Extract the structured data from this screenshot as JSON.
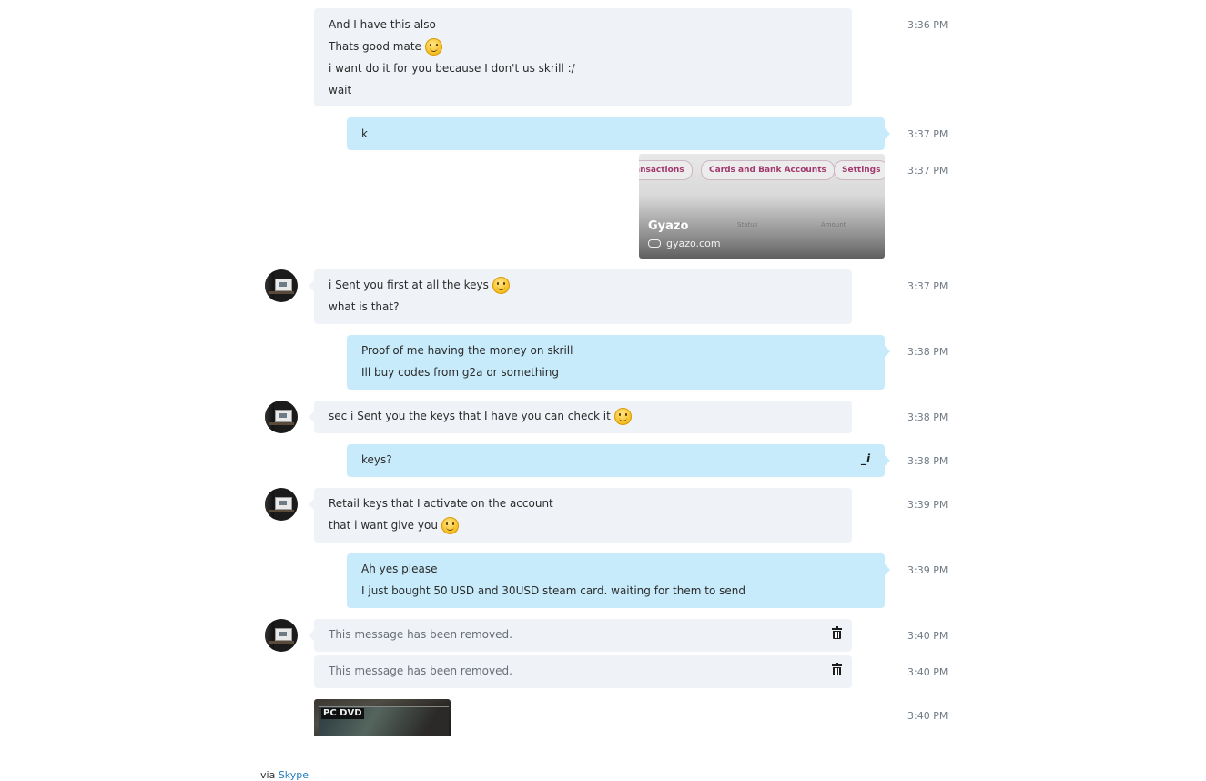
{
  "messages": [
    {
      "id": "m1",
      "time": "3:36 PM",
      "lines": [
        "And I have this also",
        "Thats good mate",
        "i want do it for you because I don't us skrill :/",
        "wait"
      ]
    },
    {
      "id": "m2",
      "time": "3:37 PM",
      "lines": [
        "k"
      ]
    },
    {
      "id": "m3",
      "time": "3:37 PM",
      "link_preview": {
        "title": "Gyazo",
        "site": "gyazo.com",
        "pills": [
          "ansactions",
          "Cards and Bank Accounts",
          "Settings"
        ],
        "columns": [
          "ate",
          "Status",
          "Amount"
        ]
      }
    },
    {
      "id": "m4",
      "time": "3:37 PM",
      "lines": [
        "i Sent you first at all the keys",
        "what is that?"
      ]
    },
    {
      "id": "m5",
      "time": "3:38 PM",
      "lines": [
        "Proof of me having the money on skrill",
        "Ill buy codes from g2a or something"
      ]
    },
    {
      "id": "m6",
      "time": "3:38 PM",
      "lines": [
        "sec i Sent you the keys that I have you can check it"
      ]
    },
    {
      "id": "m7",
      "time": "3:38 PM",
      "lines": [
        "keys?"
      ]
    },
    {
      "id": "m8",
      "time": "3:39 PM",
      "lines": [
        "Retail keys that I activate on the account",
        "that i want give you"
      ]
    },
    {
      "id": "m9",
      "time": "3:39 PM",
      "lines": [
        "Ah yes please",
        "I just bought 50 USD and 30USD steam card. waiting for them to send"
      ]
    },
    {
      "id": "m10",
      "time": "3:40 PM",
      "removed_text": "This message has been removed."
    },
    {
      "id": "m11",
      "time": "3:40 PM",
      "removed_text": "This message has been removed."
    },
    {
      "id": "m12",
      "time": "3:40 PM",
      "image_label": "PC DVD"
    }
  ],
  "footer": {
    "via": "via",
    "link": "Skype"
  },
  "colors": {
    "incoming": "#eff2f7",
    "outgoing": "#c7ebfa",
    "link": "#1f7cc0"
  },
  "icons": [
    "smiley-emoticon",
    "trash-icon",
    "edit-icon",
    "link-icon"
  ]
}
